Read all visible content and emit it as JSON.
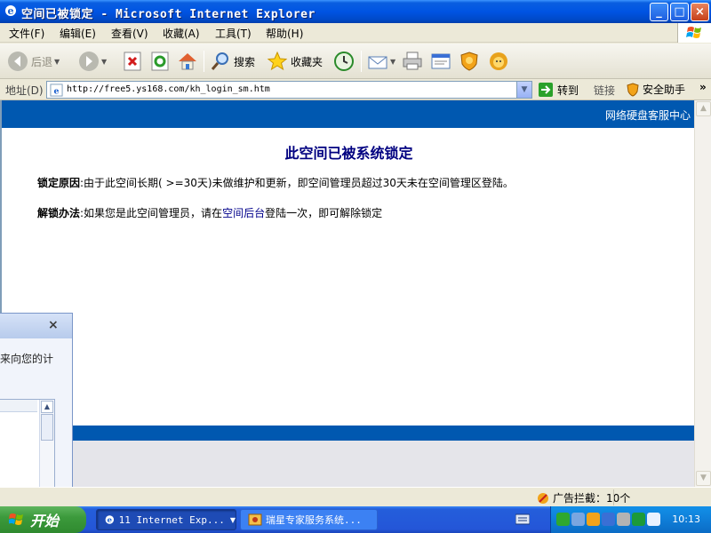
{
  "window": {
    "title": "空间已被锁定 - Microsoft Internet Explorer",
    "controls": [
      "_",
      "□",
      "×"
    ]
  },
  "menu": [
    "文件(F)",
    "编辑(E)",
    "查看(V)",
    "收藏(A)",
    "工具(T)",
    "帮助(H)"
  ],
  "toolbar": {
    "back_label": "后退",
    "search_label": "搜索",
    "favorites_label": "收藏夹"
  },
  "address": {
    "label": "地址(D)",
    "url": "http://free5.ys168.com/kh_login_sm.htm",
    "go_label": "转到",
    "links_label": "链接",
    "helper_label": "安全助手"
  },
  "page": {
    "service_link": "网络硬盘客服中心",
    "title": "此空间已被系统锁定",
    "reason_label": "锁定原因",
    "reason_text": ":由于此空间长期( >=30天)未做维护和更新，即空间管理员超过30天未在空间管理区登陆。",
    "unlock_label": "解锁办法",
    "unlock_text_before": ":如果您是此空间管理员，请在",
    "unlock_link": "空间后台",
    "unlock_text_after": "登陆一次，即可解除锁定"
  },
  "dialog": {
    "close": "×",
    "text": "来向您的计"
  },
  "statusbar": {
    "adblock": "广告拦截：10个"
  },
  "taskbar": {
    "start_label": "开始",
    "tasks": [
      "11 Internet Exp...",
      "瑞星专家服务系统..."
    ],
    "clock": "10:13"
  },
  "colors": {
    "title_bar": "#0054e3",
    "page_blue": "#0058b0",
    "title_text": "#000080",
    "link": "#00008b"
  }
}
